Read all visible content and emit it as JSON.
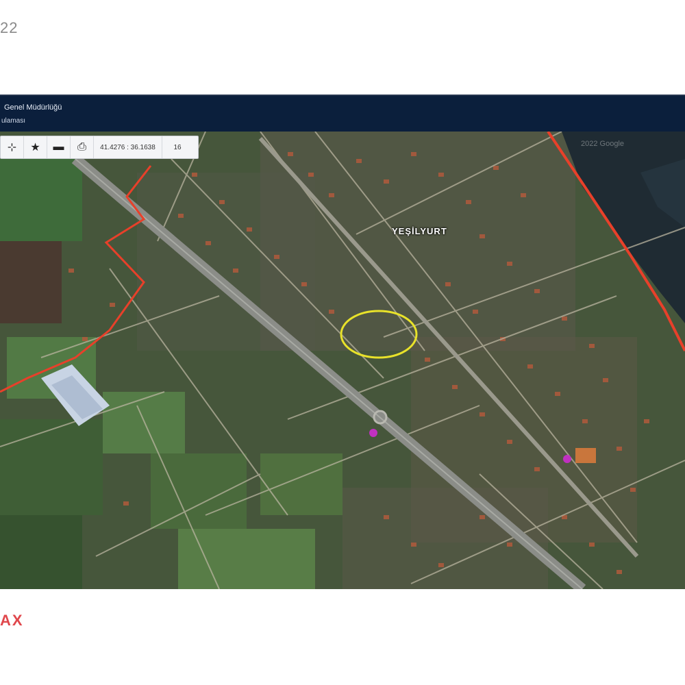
{
  "page": {
    "corner_text": "22",
    "brand_text": "AX"
  },
  "header": {
    "title": "Genel Müdürlüğü",
    "subtitle": "ulaması"
  },
  "toolbar": {
    "coordinates": "41.4276 : 36.1638",
    "zoom": "16",
    "icons": [
      "pan-icon",
      "star-icon",
      "minus-icon",
      "print-icon"
    ]
  },
  "map": {
    "place_label": "YEŞİLYURT",
    "watermark": "2022 Google",
    "colors": {
      "boundary": "#e8402a",
      "highlight_circle": "#e8e22a",
      "sea": "#1f2b33",
      "header": "#0b1f3c"
    }
  }
}
